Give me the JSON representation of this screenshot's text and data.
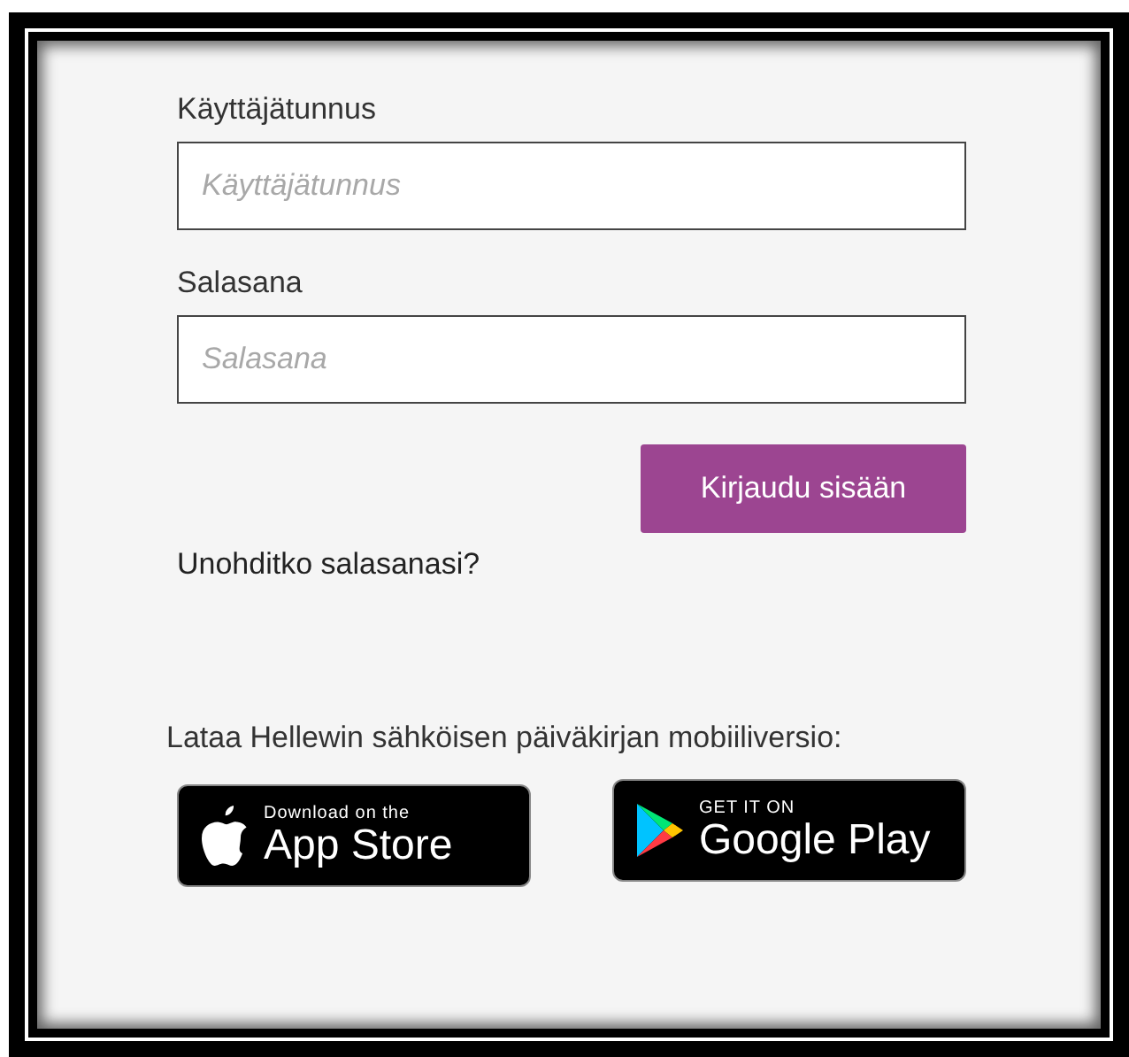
{
  "username": {
    "label": "Käyttäjätunnus",
    "placeholder": "Käyttäjätunnus"
  },
  "password": {
    "label": "Salasana",
    "placeholder": "Salasana"
  },
  "login_button": "Kirjaudu sisään",
  "forgot_link": "Unohditko salasanasi?",
  "download_text": "Lataa Hellewin sähköisen päiväkirjan mobiiliversio:",
  "store_badges": [
    {
      "kind": "apple",
      "small": "Download on the",
      "large": "App Store"
    },
    {
      "kind": "google",
      "small": "GET IT ON",
      "large": "Google Play"
    }
  ]
}
